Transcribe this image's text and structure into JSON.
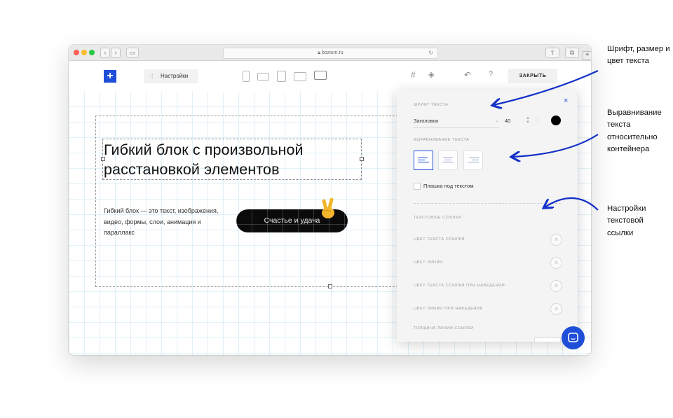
{
  "browser": {
    "url": "bozium.ru"
  },
  "toolbar": {
    "add_symbol": "+",
    "settings_label": "Настройки",
    "close_label": "ЗАКРЫТЬ",
    "help_symbol": "?"
  },
  "content": {
    "heading": "Гибкий блок с произвольной расстановкой элементов",
    "subtext": "Гибкий блок — это текст, изображения, видео, формы, слои, анимация и параллакс",
    "button_label": "Счастье и удача"
  },
  "panel": {
    "close_symbol": "×",
    "font_section": "ШРИФТ ТЕКСТА",
    "font_value": "Заголовок",
    "font_size": "40",
    "text_color": "#000000",
    "align_section": "ВЫРАВНИВАНИЕ ТЕКСТА",
    "align_options": [
      "left",
      "center",
      "right"
    ],
    "align_selected": "left",
    "underlay_label": "Плашка под текстом",
    "links_section": "ТЕКСТОВЫЕ ССЫЛКИ",
    "link_color_label": "ЦВЕТ ТЕКСТА ССЫЛКИ",
    "line_color_label": "ЦВЕТ ЛИНИИ",
    "link_hover_label": "ЦВЕТ ТЕКСТА ССЫЛКИ ПРИ НАВЕДЕНИИ",
    "line_hover_label": "ЦВЕТ ЛИНИИ ПРИ НАВЕДЕНИИ",
    "line_width_label": "ТОЛЩИНА ЛИНИИ ССЫЛКИ"
  },
  "annotations": {
    "font": "Шрифт, размер и цвет текста",
    "align": "Выравнивание текста относительно контейнера",
    "links": "Настройки текстовой ссылки"
  },
  "colors": {
    "accent": "#1f4fd8",
    "annotation_arrow": "#1330c7"
  }
}
